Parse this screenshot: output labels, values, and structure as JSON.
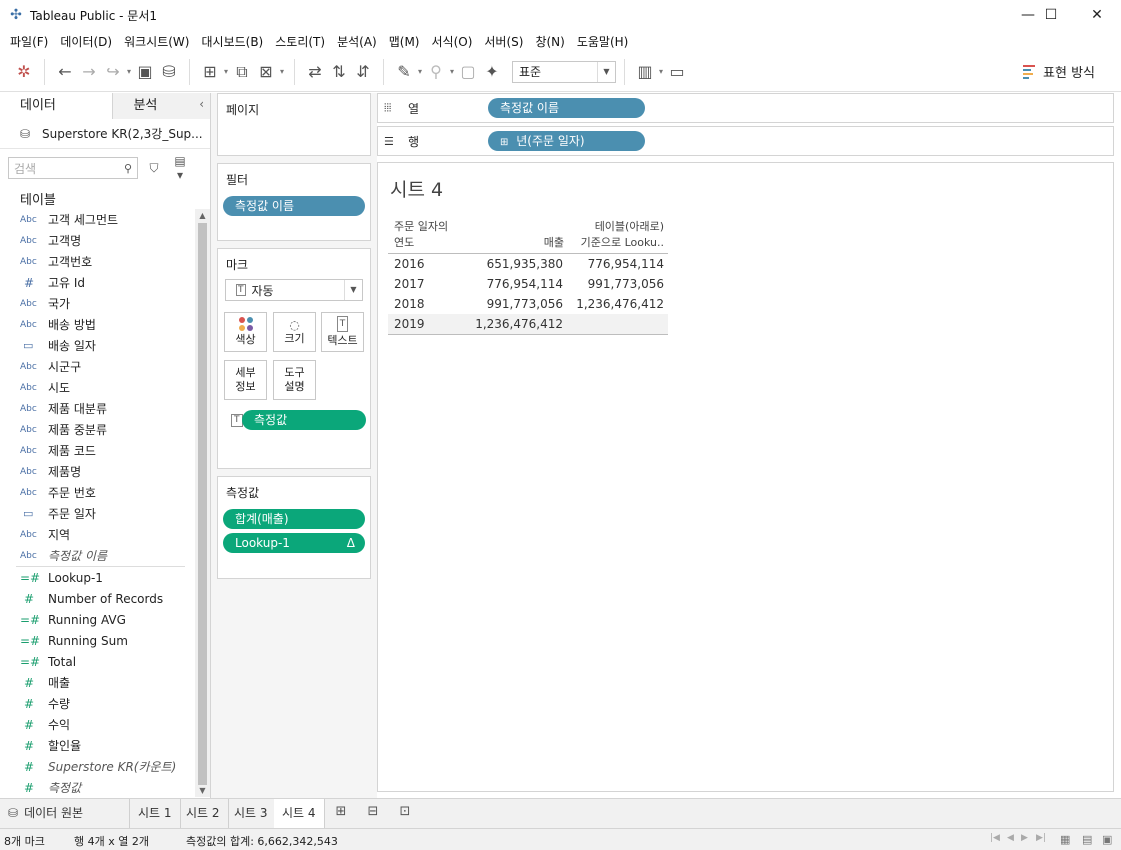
{
  "window": {
    "title": "Tableau Public - 문서1",
    "minimize": "—",
    "maximize": "☐",
    "close": "✕"
  },
  "menu": [
    "파일(F)",
    "데이터(D)",
    "워크시트(W)",
    "대시보드(B)",
    "스토리(T)",
    "분석(A)",
    "맵(M)",
    "서식(O)",
    "서버(S)",
    "창(N)",
    "도움말(H)"
  ],
  "toolbar": {
    "fit_select": "표준",
    "show_me": "표현 방식"
  },
  "data_pane": {
    "tab_data": "데이터",
    "tab_analysis": "분석",
    "datasource": "Superstore KR(2,3강_Sup...",
    "search_placeholder": "검색",
    "tables_header": "테이블",
    "dimensions": [
      {
        "type": "Abc",
        "name": "고객 세그먼트"
      },
      {
        "type": "Abc",
        "name": "고객명"
      },
      {
        "type": "Abc",
        "name": "고객번호"
      },
      {
        "type": "#",
        "name": "고유 Id"
      },
      {
        "type": "Abc",
        "name": "국가"
      },
      {
        "type": "Abc",
        "name": "배송 방법"
      },
      {
        "type": "date",
        "name": "배송 일자"
      },
      {
        "type": "Abc",
        "name": "시군구"
      },
      {
        "type": "Abc",
        "name": "시도"
      },
      {
        "type": "Abc",
        "name": "제품 대분류"
      },
      {
        "type": "Abc",
        "name": "제품 중분류"
      },
      {
        "type": "Abc",
        "name": "제품 코드"
      },
      {
        "type": "Abc",
        "name": "제품명"
      },
      {
        "type": "Abc",
        "name": "주문 번호"
      },
      {
        "type": "date",
        "name": "주문 일자"
      },
      {
        "type": "Abc",
        "name": "지역"
      },
      {
        "type": "Abc",
        "name": "측정값 이름"
      }
    ],
    "measures": [
      {
        "type": "=#",
        "name": "Lookup-1"
      },
      {
        "type": "#",
        "name": "Number of Records"
      },
      {
        "type": "=#",
        "name": "Running AVG"
      },
      {
        "type": "=#",
        "name": "Running Sum"
      },
      {
        "type": "=#",
        "name": "Total"
      },
      {
        "type": "#",
        "name": "매출"
      },
      {
        "type": "#",
        "name": "수량"
      },
      {
        "type": "#",
        "name": "수익"
      },
      {
        "type": "#",
        "name": "할인율"
      },
      {
        "type": "#",
        "name": "Superstore KR(카운트)"
      },
      {
        "type": "#",
        "name": "측정값"
      }
    ]
  },
  "cards": {
    "pages": "페이지",
    "filters": "필터",
    "filter_pill": "측정값 이름",
    "marks": "마크",
    "mark_type": "자동",
    "mark_color": "색상",
    "mark_size": "크기",
    "mark_text": "텍스트",
    "mark_detail": "세부\n정보",
    "mark_tooltip": "도구\n설명",
    "mark_pill": "측정값",
    "measure_values": "측정값",
    "mv_pill_1": "합계(매출)",
    "mv_pill_2": "Lookup-1",
    "mv_pill_2_delta": "Δ"
  },
  "shelves": {
    "columns_label": "열",
    "columns_pill": "측정값 이름",
    "rows_label": "행",
    "rows_pill": "년(주문 일자)"
  },
  "view": {
    "sheet_title": "시트 4",
    "header_year_1": "주문 일자의",
    "header_year_2": "연도",
    "header_sales": "매출",
    "header_lookup_1": "테이블(아래로)",
    "header_lookup_2": "기준으로 Looku..",
    "rows": [
      {
        "year": "2016",
        "sales": "651,935,380",
        "lookup": "776,954,114"
      },
      {
        "year": "2017",
        "sales": "776,954,114",
        "lookup": "991,773,056"
      },
      {
        "year": "2018",
        "sales": "991,773,056",
        "lookup": "1,236,476,412"
      },
      {
        "year": "2019",
        "sales": "1,236,476,412",
        "lookup": ""
      }
    ]
  },
  "sheet_tabs": {
    "datasource": "데이터 원본",
    "tabs": [
      "시트 1",
      "시트 2",
      "시트 3",
      "시트 4"
    ]
  },
  "status": {
    "marks": "8개 마크",
    "rows_cols": "행 4개  x  열 2개",
    "sum": "측정값의 합계: 6,662,342,543"
  },
  "colors": {
    "blue_pill": "#4b8fb0",
    "green_pill": "#0ba77a"
  }
}
